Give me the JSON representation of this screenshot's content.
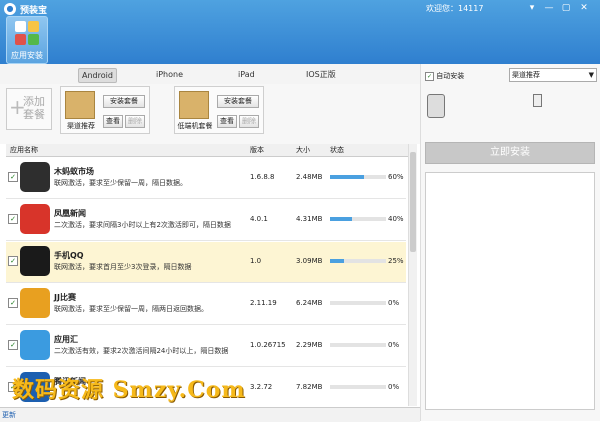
{
  "window": {
    "title": "预装宝",
    "welcome": "欢迎您：14117",
    "controls": [
      "▾",
      "—",
      "▢",
      "✕"
    ]
  },
  "toolbar": {
    "apps_label": "应用安装"
  },
  "platform_tabs": [
    "Android",
    "iPhone",
    "iPad",
    "IOS正版"
  ],
  "packages": {
    "add_label": "添加套餐",
    "items": [
      {
        "name": "渠道推荐",
        "install": "安装套餐",
        "view": "查看",
        "delete": "删除"
      },
      {
        "name": "低端机套餐",
        "install": "安装套餐",
        "view": "查看",
        "delete": "删除"
      }
    ]
  },
  "table": {
    "headers": {
      "name": "应用名称",
      "version": "版本",
      "size": "大小",
      "status": "状态"
    },
    "rows": [
      {
        "name": "木蚂蚁市场",
        "desc": "联网激活，要求至少保留一周，隔日数据。",
        "version": "1.6.8.8",
        "size": "2.48MB",
        "progress": 60,
        "pct": "60%",
        "selected": false,
        "color": "#2e2e2e"
      },
      {
        "name": "凤凰新闻",
        "desc": "二次激活，要求间隔3小时以上有2次激活即可，隔日数据",
        "version": "4.0.1",
        "size": "4.31MB",
        "progress": 40,
        "pct": "40%",
        "selected": false,
        "color": "#d8342a"
      },
      {
        "name": "手机QQ",
        "desc": "联网激活，要求首月至少3次登录，隔日数据",
        "version": "1.0",
        "size": "3.09MB",
        "progress": 25,
        "pct": "25%",
        "selected": true,
        "color": "#1a1a1a"
      },
      {
        "name": "JJ比赛",
        "desc": "联网激活，要求至少保留一周，隔两日返回数据。",
        "version": "2.11.19",
        "size": "6.24MB",
        "progress": 0,
        "pct": "0%",
        "selected": false,
        "color": "#e8a020"
      },
      {
        "name": "应用汇",
        "desc": "二次激活有效，要求2次激活间隔24小时以上，隔日数据",
        "version": "1.0.26715",
        "size": "2.29MB",
        "progress": 0,
        "pct": "0%",
        "selected": false,
        "color": "#3b9be0"
      },
      {
        "name": "腾讯新闻",
        "desc": "",
        "version": "3.2.72",
        "size": "7.82MB",
        "progress": 0,
        "pct": "0%",
        "selected": false,
        "color": "#1c5fb0"
      }
    ]
  },
  "right_panel": {
    "auto_install_label": "自动安装",
    "channel_select": "渠道推荐",
    "install_button": "立即安装"
  },
  "footer": {
    "refresh": "更新"
  },
  "watermark": "数码资源 Smzy.Com"
}
